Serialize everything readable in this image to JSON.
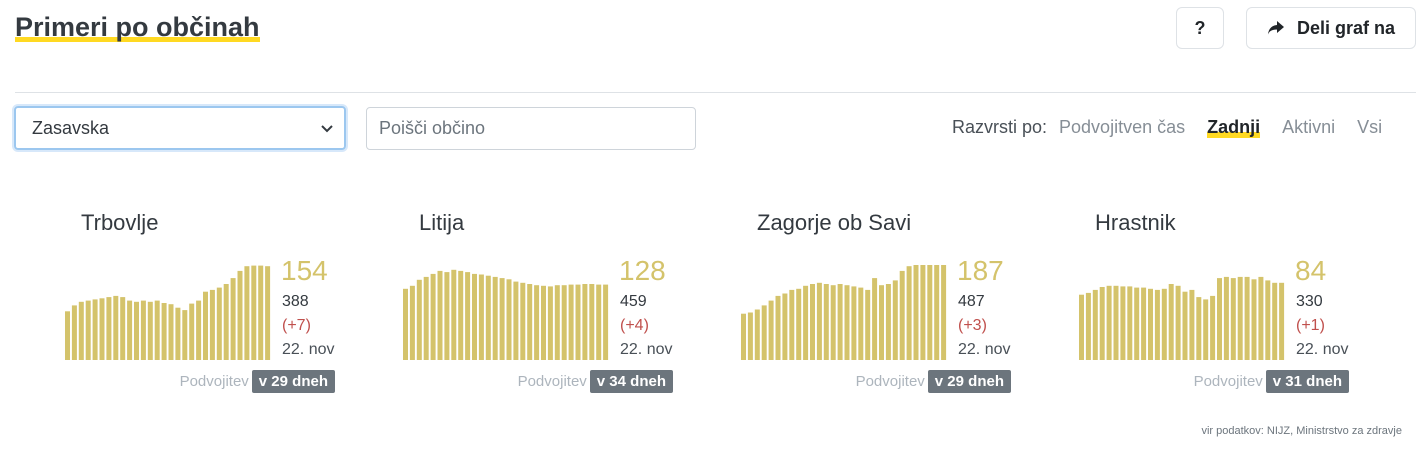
{
  "header": {
    "title": "Primeri po občinah",
    "help_label": "?",
    "share_label": "Deli graf na"
  },
  "filters": {
    "region_selected": "Zasavska",
    "search_placeholder": "Poišči občino"
  },
  "sort": {
    "label": "Razvrsti po:",
    "options": [
      "Podvojitven čas",
      "Zadnji",
      "Aktivni",
      "Vsi"
    ],
    "active": "Zadnji"
  },
  "colors": {
    "bar": "#d4c36b",
    "accent": "#ffd922",
    "delta": "#c0504d"
  },
  "cards": [
    {
      "name": "Trbovlje",
      "active": "154",
      "total": "388",
      "delta": "(+7)",
      "date": "22. nov",
      "doubling_label": "Podvojitev",
      "doubling_value": "v 29 dneh",
      "bars": [
        82,
        92,
        98,
        100,
        102,
        104,
        106,
        108,
        106,
        100,
        98,
        100,
        98,
        100,
        96,
        94,
        88,
        84,
        95,
        100,
        115,
        118,
        122,
        128,
        138,
        150,
        158,
        159,
        159,
        158
      ]
    },
    {
      "name": "Litija",
      "active": "128",
      "total": "459",
      "delta": "(+4)",
      "date": "22. nov",
      "doubling_label": "Podvojitev",
      "doubling_value": "v 34 dneh",
      "bars": [
        120,
        125,
        135,
        140,
        145,
        150,
        148,
        152,
        150,
        148,
        145,
        144,
        142,
        140,
        138,
        136,
        132,
        130,
        128,
        126,
        125,
        124,
        126,
        126,
        127,
        127,
        128,
        128,
        127,
        127
      ]
    },
    {
      "name": "Zagorje ob Savi",
      "active": "187",
      "total": "487",
      "delta": "(+3)",
      "date": "22. nov",
      "doubling_label": "Podvojitev",
      "doubling_value": "v 29 dneh",
      "bars": [
        78,
        80,
        85,
        92,
        100,
        108,
        112,
        118,
        120,
        125,
        128,
        130,
        128,
        126,
        128,
        126,
        124,
        122,
        118,
        138,
        126,
        128,
        134,
        150,
        158,
        162,
        165,
        163,
        160,
        160
      ]
    },
    {
      "name": "Hrastnik",
      "active": "84",
      "total": "330",
      "delta": "(+1)",
      "date": "22. nov",
      "doubling_label": "Podvojitev",
      "doubling_value": "v 31 dneh",
      "bars": [
        110,
        113,
        118,
        123,
        125,
        125,
        124,
        124,
        122,
        122,
        120,
        118,
        120,
        128,
        125,
        115,
        118,
        106,
        102,
        108,
        138,
        140,
        138,
        140,
        140,
        136,
        140,
        134,
        130,
        130
      ]
    }
  ],
  "source": "vir podatkov: NIJZ, Ministrstvo za zdravje"
}
